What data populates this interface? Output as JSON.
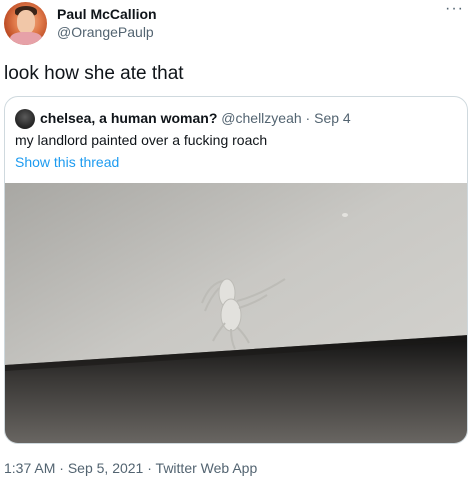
{
  "author": {
    "display_name": "Paul McCallion",
    "handle": "@OrangePaulp"
  },
  "more_icon": "···",
  "tweet": {
    "text": "look how she ate that"
  },
  "quote": {
    "display_name": "chelsea, a human woman?",
    "handle": "@chellzyeah",
    "separator": " · ",
    "date": "Sep 4",
    "text": "my landlord painted over a fucking roach",
    "show_thread": "Show this thread"
  },
  "footer": {
    "time": "1:37 AM",
    "sep1": " · ",
    "date": "Sep 5, 2021",
    "sep2": " · ",
    "source": "Twitter Web App"
  },
  "colors": {
    "link": "#1d9bf0",
    "secondary_text": "#536471",
    "border": "#cfd9de"
  }
}
